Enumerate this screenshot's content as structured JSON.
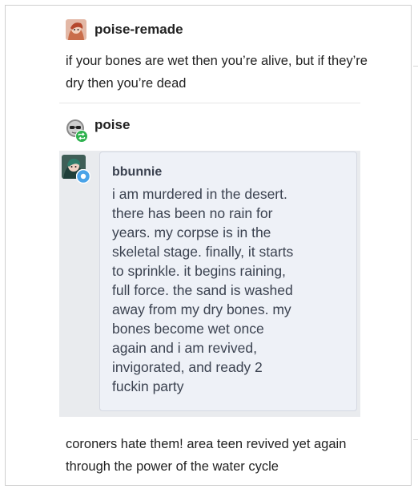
{
  "post": {
    "author": "poise-remade",
    "body": "if your bones are wet then you’re alive, but if they’re dry then you’re dead"
  },
  "reblog": {
    "author": "poise"
  },
  "quote": {
    "author": "bbunnie",
    "body": "i am murdered in the desert.\nthere has been no rain for\nyears. my corpse is in the\nskeletal stage. finally, it starts\nto sprinkle. it begins raining,\nfull force. the sand is washed\naway from my dry bones. my\nbones become wet once\nagain and i am revived,\ninvigorated, and ready 2\nfuckin party"
  },
  "comment": {
    "body": "coroners hate them! area teen revived yet again through the power of the water cycle"
  },
  "colors": {
    "reblog_badge": "#2fb24f",
    "verified_badge": "#4aa3e8",
    "quote_background": "#eef1f7"
  },
  "icons": {
    "poise_remade_avatar": "cartoon-portrait-avatar",
    "poise_avatar": "sunglasses-face-avatar",
    "reblog_badge": "reblog-icon",
    "bbunnie_avatar": "character-portrait-avatar",
    "verified_badge": "checkmark-badge-icon"
  }
}
